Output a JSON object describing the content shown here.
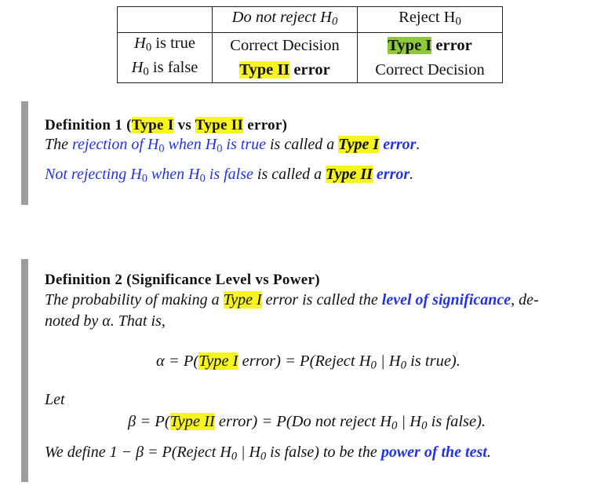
{
  "table": {
    "col_headers": [
      "",
      "Do not reject H",
      "Reject H"
    ],
    "sub_zero": "0",
    "rows": [
      {
        "label": "H",
        "label_rest": " is true",
        "c1": "Correct Decision",
        "c2_hl": "Type I",
        "c2_rest": " error"
      },
      {
        "label": "H",
        "label_rest": " is false",
        "c1_hl": "Type II",
        "c1_rest": " error",
        "c2": "Correct Decision"
      }
    ]
  },
  "def1": {
    "title_a": "Definition 1 (",
    "title_type1": "Type I",
    "title_vs": " vs ",
    "title_type2": "Type II",
    "title_b": " error)",
    "line1": {
      "p1": "The ",
      "blue1": "rejection of H",
      "blue2": " when H",
      "blue3": " is true",
      "p2": " is called a ",
      "hl": "Type I",
      "blue4": " error",
      "p3": "."
    },
    "line2": {
      "blue1": "Not rejecting H",
      "blue2": " when H",
      "blue3": " is false",
      "p2": " is called a ",
      "hl": "Type II",
      "blue4": " error",
      "p3": "."
    }
  },
  "def2": {
    "title": "Definition 2 (Significance Level vs Power)",
    "line1": {
      "p1": "The probability of making a ",
      "hl": "Type I",
      "p2": " error is called the ",
      "blue": "level of significance",
      "p3": ", de-"
    },
    "line2": "noted by α.  That is,",
    "eq1": {
      "a": "α = P(",
      "hl": "Type I",
      "b": " error) = P(Reject H",
      "c": " | H",
      "d": " is true)."
    },
    "let": "Let",
    "eq2": {
      "a": "β = P(",
      "hl": "Type II",
      "b": " error) = P(Do not reject H",
      "c": " | H",
      "d": " is false)."
    },
    "line3": {
      "a": "We define 1 − β = P(Reject H",
      "b": " | H",
      "c": " is false) to be the ",
      "blue": "power of the test",
      "d": "."
    }
  }
}
